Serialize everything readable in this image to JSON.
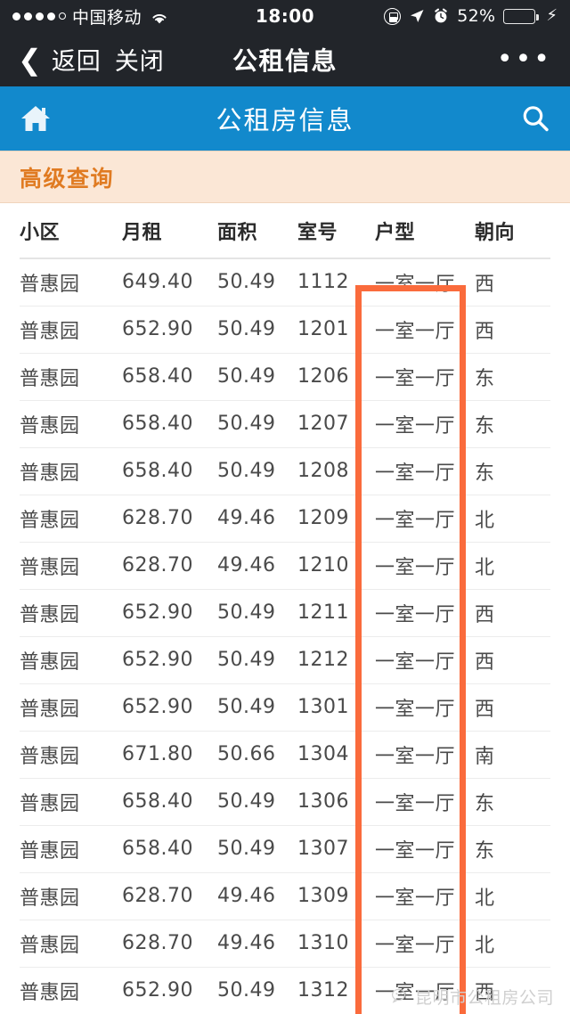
{
  "status_bar": {
    "signal_dots_filled": 4,
    "signal_dots_total": 5,
    "carrier": "中国移动",
    "wifi_icon": "wifi-icon",
    "time": "18:00",
    "rotation_lock_icon": "rotation-lock-icon",
    "location_icon": "location-arrow-icon",
    "alarm_icon": "alarm-clock-icon",
    "battery_percent": "52%",
    "battery_level": 52,
    "charging_icon": "lightning-bolt-icon"
  },
  "nav_bar": {
    "back_icon": "chevron-left-icon",
    "back_label": "返回",
    "close_label": "关闭",
    "title": "公租信息",
    "more_label": "•••"
  },
  "app_bar": {
    "home_icon": "home-icon",
    "title": "公租房信息",
    "search_icon": "search-icon",
    "background_color": "#1289cc"
  },
  "banner": {
    "label": "高级查询",
    "text_color": "#e07b22",
    "background_color": "#fbe7d6"
  },
  "table": {
    "columns": [
      "小区",
      "月租",
      "面积",
      "室号",
      "户型",
      "朝向"
    ],
    "rows": [
      [
        "普惠园",
        "649.40",
        "50.49",
        "1112",
        "一室一厅",
        "西"
      ],
      [
        "普惠园",
        "652.90",
        "50.49",
        "1201",
        "一室一厅",
        "西"
      ],
      [
        "普惠园",
        "658.40",
        "50.49",
        "1206",
        "一室一厅",
        "东"
      ],
      [
        "普惠园",
        "658.40",
        "50.49",
        "1207",
        "一室一厅",
        "东"
      ],
      [
        "普惠园",
        "658.40",
        "50.49",
        "1208",
        "一室一厅",
        "东"
      ],
      [
        "普惠园",
        "628.70",
        "49.46",
        "1209",
        "一室一厅",
        "北"
      ],
      [
        "普惠园",
        "628.70",
        "49.46",
        "1210",
        "一室一厅",
        "北"
      ],
      [
        "普惠园",
        "652.90",
        "50.49",
        "1211",
        "一室一厅",
        "西"
      ],
      [
        "普惠园",
        "652.90",
        "50.49",
        "1212",
        "一室一厅",
        "西"
      ],
      [
        "普惠园",
        "652.90",
        "50.49",
        "1301",
        "一室一厅",
        "西"
      ],
      [
        "普惠园",
        "671.80",
        "50.66",
        "1304",
        "一室一厅",
        "南"
      ],
      [
        "普惠园",
        "658.40",
        "50.49",
        "1306",
        "一室一厅",
        "东"
      ],
      [
        "普惠园",
        "658.40",
        "50.49",
        "1307",
        "一室一厅",
        "东"
      ],
      [
        "普惠园",
        "628.70",
        "49.46",
        "1309",
        "一室一厅",
        "北"
      ],
      [
        "普惠园",
        "628.70",
        "49.46",
        "1310",
        "一室一厅",
        "北"
      ],
      [
        "普惠园",
        "652.90",
        "50.49",
        "1312",
        "一室一厅",
        "西"
      ]
    ]
  },
  "highlight": {
    "column": "户型",
    "color": "#fa6b3c"
  },
  "watermark": {
    "logo_icon": "wechat-logo-icon",
    "text": "昆明市公租房公司"
  }
}
